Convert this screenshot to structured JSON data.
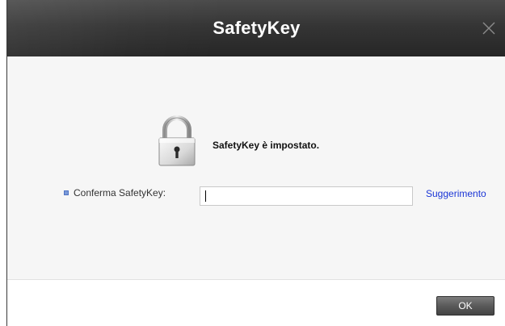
{
  "dialog": {
    "title": "SafetyKey",
    "close_icon": "close-icon"
  },
  "content": {
    "lock_icon": "padlock-icon",
    "status_message": "SafetyKey è impostato.",
    "field_label": "Conferma SafetyKey:",
    "input_value": "",
    "hint_link": "Suggerimento"
  },
  "footer": {
    "ok_label": "OK"
  },
  "colors": {
    "titlebar": "#353535",
    "body": "#f6f6f6",
    "link": "#1a35d6",
    "button": "#5a5a5a"
  }
}
